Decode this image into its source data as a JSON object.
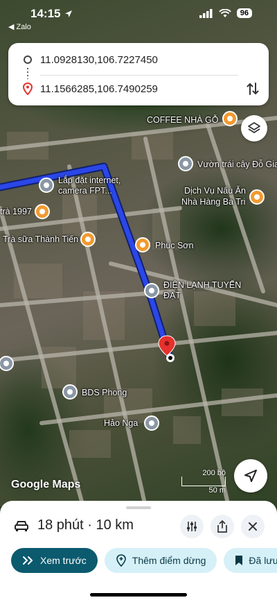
{
  "status_bar": {
    "time": "14:15",
    "back_app": "Zalo",
    "battery": "96"
  },
  "route": {
    "origin": "11.0928130,106.7227450",
    "destination": "11.1566285,106.7490259"
  },
  "map": {
    "labels": {
      "coffee": "COFFEE NHÀ GỖ",
      "vuon": "Vườn trái cây Đỗ Gia",
      "lap_dat_1": "Lắp đặt internet,",
      "lap_dat_2": "camera FPT...",
      "dich_vu_1": "Dịch Vụ Nấu Ăn",
      "dich_vu_2": "Nhà Hàng Ba Tri",
      "tra_1997": "trà 1997",
      "tra_sua": "Trà sữa Thành Tiến",
      "phuc_son": "Phúc Sơn",
      "dien_lanh_1": "ĐIỆN LẠNH TUYẾN",
      "dien_lanh_2": "ĐẠT",
      "bds": "BDS Phong",
      "hao_nga": "Hảo Nga"
    },
    "watermark": "Google Maps",
    "scale_top": "200 bộ",
    "scale_bottom": "50 m",
    "route_color": "#2b47e8",
    "pin_color": "#e5322e"
  },
  "sheet": {
    "trip_summary": "18 phút · 10 km",
    "preview_label": "Xem trước",
    "add_stop_label": "Thêm điểm dừng",
    "saved_label": "Đã lưu",
    "primary_color": "#0b5a6e",
    "secondary_color": "#d6f0f8"
  }
}
